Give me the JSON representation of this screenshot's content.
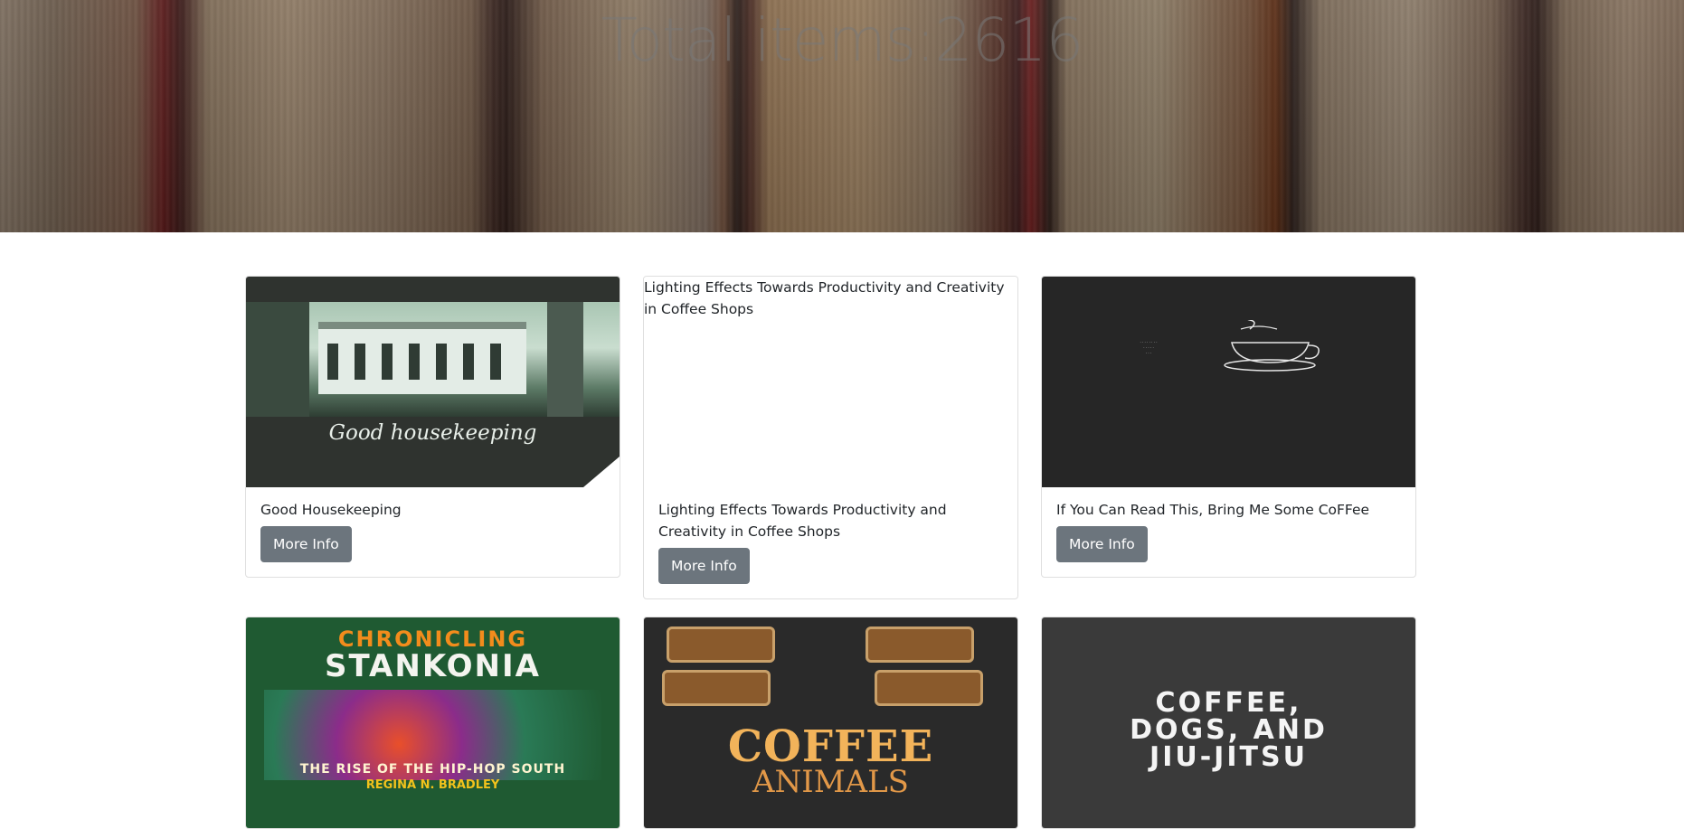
{
  "header": {
    "title": "Total items:2616"
  },
  "cards": [
    {
      "title": "Good Housekeeping",
      "image_text": "Good housekeeping",
      "button_label": "More Info"
    },
    {
      "title": "Lighting Effects Towards Productivity and Creativity in Coffee Shops",
      "image_alt": "Lighting Effects Towards Productivity and Creativity in Coffee Shops",
      "button_label": "More Info"
    },
    {
      "title": "If You Can Read This, Bring Me Some CoFFee",
      "button_label": "More Info"
    },
    {
      "image_text_top": "CHRONICLING",
      "image_text_main": "STANKONIA",
      "image_text_sub": "THE RISE OF THE HIP-HOP SOUTH",
      "image_text_author": "REGINA N. BRADLEY"
    },
    {
      "image_text_main": "COFFEE",
      "image_text_sub": "ANIMALS"
    },
    {
      "image_text_lines": [
        "COFFEE,",
        "DOGS, AND",
        "JIU-JITSU"
      ]
    }
  ],
  "colors": {
    "button_bg": "#6c757d",
    "card_border": "rgba(0,0,0,0.125)",
    "text": "#212529"
  }
}
